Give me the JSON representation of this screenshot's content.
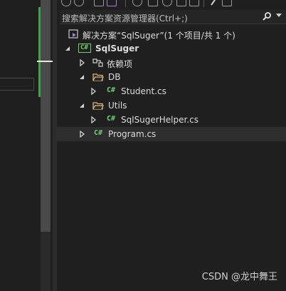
{
  "search": {
    "placeholder": "搜索解决方案资源管理器(Ctrl+;)"
  },
  "tree": {
    "solution": "解决方案“SqlSuger”(1 个项目/共 1 个)",
    "project": "SqlSuger",
    "project_badge": "C#",
    "dependencies": "依赖项",
    "folder_db": "DB",
    "file_student": "Student.cs",
    "folder_utils": "Utils",
    "file_helper": "SqlSugerHelper.cs",
    "file_program": "Program.cs",
    "cs_badge": "C#"
  },
  "watermark": "CSDN @龙中舞王",
  "colors": {
    "accent_green": "#3fa34d",
    "folder": "#dcb67a",
    "csharp": "#6fcf6f"
  }
}
